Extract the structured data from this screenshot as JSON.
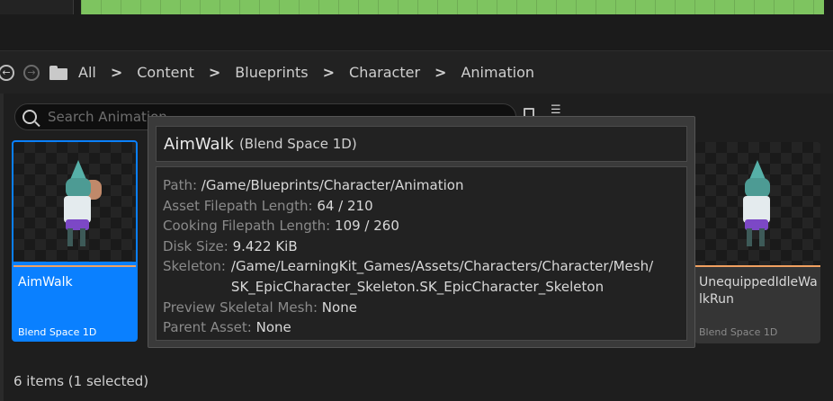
{
  "breadcrumb": {
    "items": [
      "All",
      "Content",
      "Blueprints",
      "Character",
      "Animation"
    ],
    "separator": ">"
  },
  "search": {
    "placeholder": "Search Animation"
  },
  "assets": [
    {
      "name": "AimWalk",
      "type": "Blend Space 1D",
      "selected": true
    },
    {
      "name": "UnequippedIdleWalkRun",
      "type": "Blend Space 1D",
      "selected": false
    }
  ],
  "status": "6 items (1 selected)",
  "tooltip": {
    "title": "AimWalk",
    "subtitle": "(Blend Space 1D)",
    "rows": [
      {
        "key": "Path:",
        "value": "/Game/Blueprints/Character/Animation"
      },
      {
        "key": "Asset Filepath Length:",
        "value": "64 / 210"
      },
      {
        "key": "Cooking Filepath Length:",
        "value": "109 / 260"
      },
      {
        "key": "Disk Size:",
        "value": "9.422 KiB"
      }
    ],
    "skeleton": {
      "key": "Skeleton:",
      "line1": "/Game/LearningKit_Games/Assets/Characters/Character/Mesh/",
      "line2": "SK_EpicCharacter_Skeleton.SK_EpicCharacter_Skeleton"
    },
    "rows2": [
      {
        "key": "Preview Skeletal Mesh:",
        "value": "None"
      },
      {
        "key": "Parent Asset:",
        "value": "None"
      }
    ]
  },
  "colors": {
    "selection": "#0a80ff",
    "asset_stripe": "#f0a060",
    "viewport_grass": "#7ec460"
  },
  "icons": [
    "back-icon",
    "forward-icon",
    "folder-icon",
    "search-icon",
    "save-search-icon",
    "filter-icon"
  ]
}
